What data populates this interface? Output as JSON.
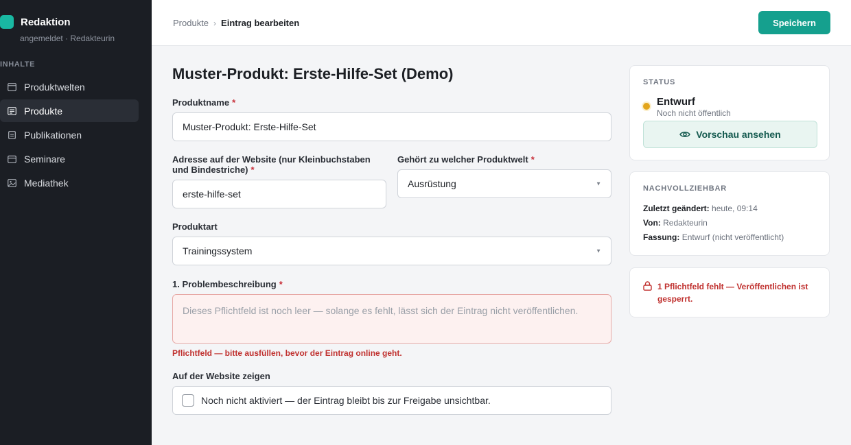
{
  "sidebar": {
    "brand": "Redaktion",
    "subtitle": "angemeldet · Redakteurin",
    "section_label": "INHALTE",
    "items": [
      {
        "label": "Produktwelten",
        "icon": "window-icon",
        "active": false
      },
      {
        "label": "Produkte",
        "icon": "list-icon",
        "active": true
      },
      {
        "label": "Publikationen",
        "icon": "document-icon",
        "active": false
      },
      {
        "label": "Seminare",
        "icon": "calendar-icon",
        "active": false
      },
      {
        "label": "Mediathek",
        "icon": "image-icon",
        "active": false
      }
    ]
  },
  "topbar": {
    "breadcrumb_parent": "Produkte",
    "breadcrumb_separator": "›",
    "breadcrumb_current": "Eintrag bearbeiten",
    "save_label": "Speichern"
  },
  "form": {
    "title": "Muster-Produkt: Erste-Hilfe-Set (Demo)",
    "name_label": "Produktname",
    "name_value": "Muster-Produkt: Erste-Hilfe-Set",
    "slug_label": "Adresse auf der Website (nur Kleinbuchstaben und Bindestriche)",
    "slug_value": "erste-hilfe-set",
    "world_label": "Gehört zu welcher Produktwelt",
    "world_value": "Ausrüstung",
    "type_label": "Produktart",
    "type_value": "Trainingssystem",
    "problem_label": "1. Problembeschreibung",
    "problem_placeholder": "Dieses Pflichtfeld ist noch leer — solange es fehlt, lässt sich der Eintrag nicht veröffentlichen.",
    "problem_error": "Pflichtfeld — bitte ausfüllen, bevor der Eintrag online geht.",
    "visible_label": "Auf der Website zeigen",
    "visible_text": "Noch nicht aktiviert — der Eintrag bleibt bis zur Freigabe unsichtbar.",
    "required_mark": "*"
  },
  "status_card": {
    "heading": "STATUS",
    "state": "Entwurf",
    "state_sub": "Noch nicht öffentlich",
    "preview_label": "Vorschau ansehen"
  },
  "trace_card": {
    "heading": "NACHVOLLZIEHBAR",
    "changed_key": "Zuletzt geändert:",
    "changed_value": "heute, 09:14",
    "by_key": "Von:",
    "by_value": "Redakteurin",
    "version_key": "Fassung:",
    "version_value": "Entwurf (nicht veröffentlicht)"
  },
  "lock_card": {
    "message": "1 Pflichtfeld fehlt — Veröffentlichen ist gesperrt."
  },
  "colors": {
    "accent": "#15a08e",
    "sidebar_bg": "#1b1e24",
    "error": "#c0312f",
    "draft_dot": "#e3a51c"
  }
}
